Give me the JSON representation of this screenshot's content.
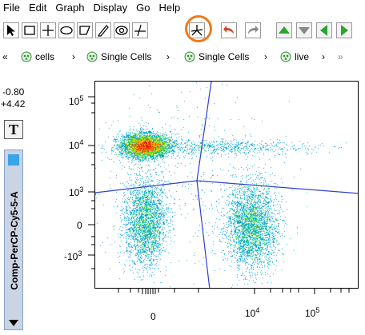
{
  "menu": [
    "File",
    "Edit",
    "Graph",
    "Display",
    "Go",
    "Help"
  ],
  "toolbar": {
    "tools": [
      "pointer-icon",
      "rectangle-gate-icon",
      "quadrant-gate-icon",
      "ellipse-gate-icon",
      "polygon-gate-icon",
      "freehand-gate-icon",
      "web-gate-icon",
      "curly-quad-gate-icon",
      "spider-quad-gate-icon"
    ],
    "highlighted_tool": "spider-quad-gate-icon",
    "undo": "undo-icon",
    "redo": "redo-icon",
    "nav": [
      "up-arrow-icon",
      "down-arrow-icon",
      "left-arrow-icon",
      "right-arrow-icon"
    ],
    "accent": "#f07a1a",
    "nav_color": "#2aa52a"
  },
  "breadcrumb": {
    "prefix": "«",
    "items": [
      "cells",
      "Single Cells",
      "Single Cells",
      "live"
    ],
    "sep": "›",
    "suffix": "»"
  },
  "readout": {
    "x": "-0.80",
    "y": "+4.42"
  },
  "text_button": "T",
  "y_axis_label": "Comp-PerCP-Cy5-5-A",
  "y_ticks": [
    {
      "base": "10",
      "exp": "5"
    },
    {
      "base": "10",
      "exp": "4"
    },
    {
      "base": "10",
      "exp": "3"
    },
    {
      "base": "0",
      "exp": ""
    },
    {
      "base": "-10",
      "exp": "3"
    }
  ],
  "x_ticks": [
    {
      "base": "0",
      "exp": ""
    },
    {
      "base": "10",
      "exp": "4"
    },
    {
      "base": "10",
      "exp": "5"
    }
  ],
  "chart_data": {
    "type": "scatter",
    "title": "",
    "ylabel": "Comp-PerCP-Cy5-5-A",
    "xlabel": "",
    "y_tick_labels": [
      "10^5",
      "10^4",
      "10^3",
      "0",
      "-10^3"
    ],
    "x_tick_labels": [
      "0",
      "10^4",
      "10^5"
    ],
    "colormap": "density (blue-green-yellow-red)",
    "populations": [
      {
        "name": "upper-left",
        "x": 0,
        "y": 10000
      },
      {
        "name": "lower-left",
        "x": 0,
        "y": 0
      },
      {
        "name": "lower-right",
        "x": 10000,
        "y": 0
      }
    ]
  }
}
